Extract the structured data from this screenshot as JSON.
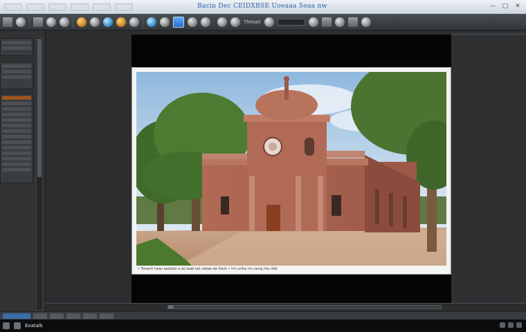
{
  "window": {
    "title": "Bacin Dec CEIDXBSE Uoeaaa Soaa nw",
    "controls": [
      "—",
      "□",
      "✕"
    ]
  },
  "menu": {
    "items": [
      "",
      "",
      "",
      "",
      "",
      ""
    ]
  },
  "toolbar": {
    "label_1": "",
    "label_2": "Thmati"
  },
  "viewport": {
    "caption": "• Tonenh heas aadstat a ak teab tek rebaa da Stein • hin arihe rm ramg rhe ntbl"
  },
  "timeline": {
    "progress": 0.02
  },
  "taskbar": {
    "app_label": "Exatalk"
  },
  "colors": {
    "accent": "#a4551e",
    "selection": "#2a6fd0",
    "title_text": "#2b5ea8"
  }
}
